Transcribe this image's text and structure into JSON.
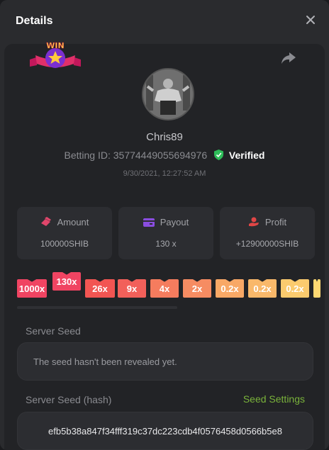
{
  "modal": {
    "title": "Details",
    "close_icon": "close-icon",
    "share_icon": "share-icon",
    "badge_text": "WIN"
  },
  "player": {
    "username": "Chris89",
    "betting_id": "Betting ID: 35774449055694976",
    "verified_label": "Verified",
    "timestamp": "9/30/2021, 12:27:52 AM"
  },
  "stats": [
    {
      "label": "Amount",
      "value": "100000SHIB",
      "icon": "coins-icon",
      "color": "#e0466b"
    },
    {
      "label": "Payout",
      "value": "130 x",
      "icon": "wallet-icon",
      "color": "#8a4de0"
    },
    {
      "label": "Profit",
      "value": "+12900000SHIB",
      "icon": "hand-coin-icon",
      "color": "#e04646"
    }
  ],
  "multipliers": [
    {
      "label": "1000x",
      "color": "#f04462"
    },
    {
      "label": "130x",
      "color": "#f04462",
      "selected": true
    },
    {
      "label": "26x",
      "color": "#f25552"
    },
    {
      "label": "9x",
      "color": "#f2605a"
    },
    {
      "label": "4x",
      "color": "#f57c5e"
    },
    {
      "label": "2x",
      "color": "#f68c62"
    },
    {
      "label": "0.2x",
      "color": "#f8a866"
    },
    {
      "label": "0.2x",
      "color": "#f9b86a"
    },
    {
      "label": "0.2x",
      "color": "#fbcb6e"
    },
    {
      "label": "",
      "color": "#fdd872"
    }
  ],
  "server_seed": {
    "label": "Server Seed",
    "value": "The seed hasn't been revealed yet."
  },
  "server_seed_hash": {
    "label": "Server Seed (hash)",
    "settings_link": "Seed Settings",
    "value": "efb5b38a847f34fff319c37dc223cdb4f0576458d0566b5e8"
  }
}
